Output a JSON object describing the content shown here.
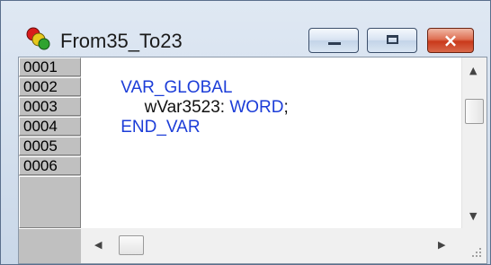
{
  "window": {
    "title": "From35_To23",
    "icon": "db-status-lights-icon",
    "controls": {
      "minimize": "minimize-icon",
      "maximize": "maximize-icon",
      "close": "×"
    }
  },
  "editor": {
    "line_numbers": [
      "0001",
      "0002",
      "0003",
      "0004",
      "0005",
      "0006"
    ],
    "lines": [
      {
        "segments": [
          {
            "text": "VAR_GLOBAL",
            "kind": "keyword"
          }
        ]
      },
      {
        "segments": [
          {
            "text": "     wVar3523: ",
            "kind": "identifier"
          },
          {
            "text": "WORD",
            "kind": "keyword"
          },
          {
            "text": ";",
            "kind": "identifier"
          }
        ]
      },
      {
        "segments": [
          {
            "text": "END_VAR",
            "kind": "keyword"
          }
        ]
      }
    ],
    "colors": {
      "keyword": "#1c3dd8",
      "identifier": "#111111",
      "gutter": "#c0c0c0"
    }
  }
}
